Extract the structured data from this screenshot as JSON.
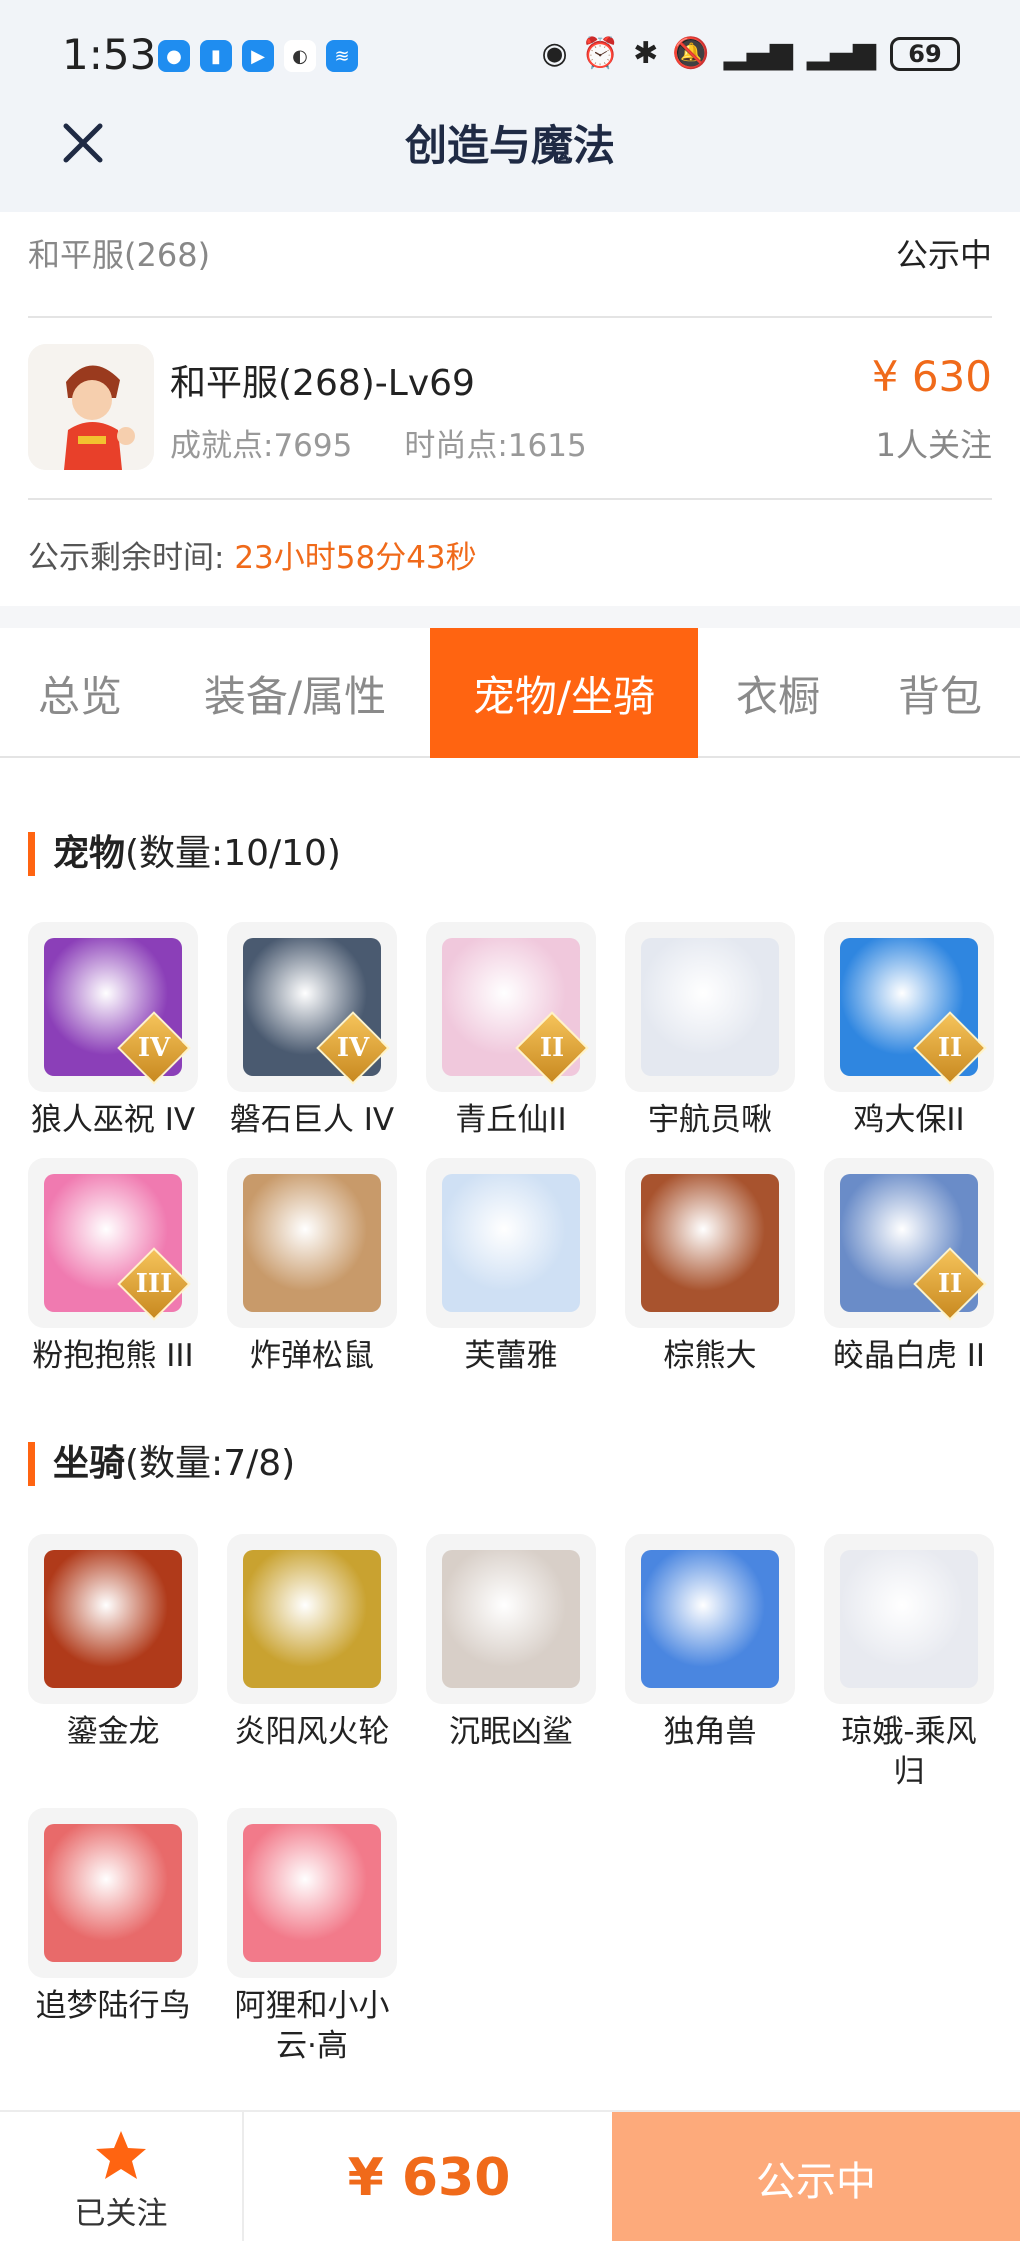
{
  "status_bar": {
    "time": "1:53",
    "battery": "69"
  },
  "header": {
    "title": "创造与魔法"
  },
  "listing": {
    "server": "和平服(268)",
    "status": "公示中",
    "role_name": "和平服(268)-Lv69",
    "achievement": "成就点:7695",
    "fashion": "时尚点:1615",
    "price": "¥ 630",
    "followers": "1人关注",
    "countdown_label": "公示剩余时间:",
    "countdown_value": "23小时58分43秒"
  },
  "tabs": [
    {
      "label": "总览",
      "active": false
    },
    {
      "label": "装备/属性",
      "active": false
    },
    {
      "label": "宠物/坐骑",
      "active": true
    },
    {
      "label": "衣橱",
      "active": false
    },
    {
      "label": "背包",
      "active": false
    }
  ],
  "pets": {
    "title": "宠物",
    "count": "(数量:10/10)",
    "items": [
      {
        "name": "狼人巫祝 IV",
        "rank": "IV",
        "color": "#8b3fb8"
      },
      {
        "name": "磐石巨人 IV",
        "rank": "IV",
        "color": "#4a5a70"
      },
      {
        "name": "青丘仙II",
        "rank": "II",
        "color": "#f0c8dc"
      },
      {
        "name": "宇航员啾",
        "rank": "",
        "color": "#e4e8f0"
      },
      {
        "name": "鸡大保II",
        "rank": "II",
        "color": "#2f86e0"
      },
      {
        "name": "粉抱抱熊 III",
        "rank": "III",
        "color": "#f07ab0"
      },
      {
        "name": "炸弹松鼠",
        "rank": "",
        "color": "#c89a6a"
      },
      {
        "name": "芙蕾雅",
        "rank": "",
        "color": "#cfe0f4"
      },
      {
        "name": "棕熊大",
        "rank": "",
        "color": "#a8532e"
      },
      {
        "name": "皎晶白虎 II",
        "rank": "II",
        "color": "#6a8cc8"
      }
    ]
  },
  "mounts": {
    "title": "坐骑",
    "count": "(数量:7/8)",
    "items": [
      {
        "name": "鎏金龙",
        "color": "#b03a1a"
      },
      {
        "name": "炎阳风火轮",
        "color": "#c9a230"
      },
      {
        "name": "沉眠凶鲨",
        "color": "#d8cfc8"
      },
      {
        "name": "独角兽",
        "color": "#4a86e0"
      },
      {
        "name": "琼娥-乘风归",
        "color": "#e8eaf0"
      },
      {
        "name": "追梦陆行鸟",
        "color": "#e86a6a"
      },
      {
        "name": "阿狸和小小云·高",
        "color": "#f27a8a"
      }
    ]
  },
  "bottom_bar": {
    "follow_label": "已关注",
    "price": "¥ 630",
    "cta": "公示中"
  },
  "colors": {
    "accent": "#ff6411",
    "price": "#f06a1a",
    "cta_bg": "#fdaa7b"
  }
}
